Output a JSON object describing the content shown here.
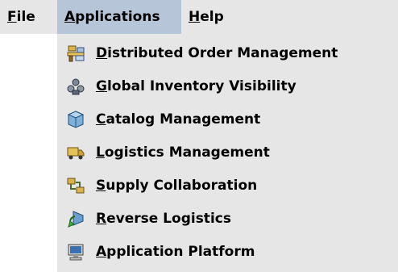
{
  "menubar": {
    "items": [
      {
        "mnemonic": "F",
        "rest": "ile"
      },
      {
        "mnemonic": "A",
        "rest": "pplications"
      },
      {
        "mnemonic": "H",
        "rest": "elp"
      }
    ],
    "active_index": 1,
    "colors": {
      "bar": "#e6e6e6",
      "active": "#b7c5d9"
    }
  },
  "applications_menu": {
    "items": [
      {
        "mnemonic": "D",
        "rest": "istributed Order Management",
        "icon": "order-management-icon"
      },
      {
        "mnemonic": "G",
        "rest": "lobal Inventory Visibility",
        "icon": "inventory-visibility-icon"
      },
      {
        "mnemonic": "C",
        "rest": "atalog Management",
        "icon": "catalog-icon"
      },
      {
        "mnemonic": "L",
        "rest": "ogistics Management",
        "icon": "logistics-truck-icon"
      },
      {
        "mnemonic": "S",
        "rest": "upply Collaboration",
        "icon": "supply-collaboration-icon"
      },
      {
        "mnemonic": "R",
        "rest": "everse Logistics",
        "icon": "reverse-logistics-icon"
      },
      {
        "mnemonic": "A",
        "rest": "pplication Platform",
        "icon": "computer-monitor-icon"
      }
    ]
  }
}
